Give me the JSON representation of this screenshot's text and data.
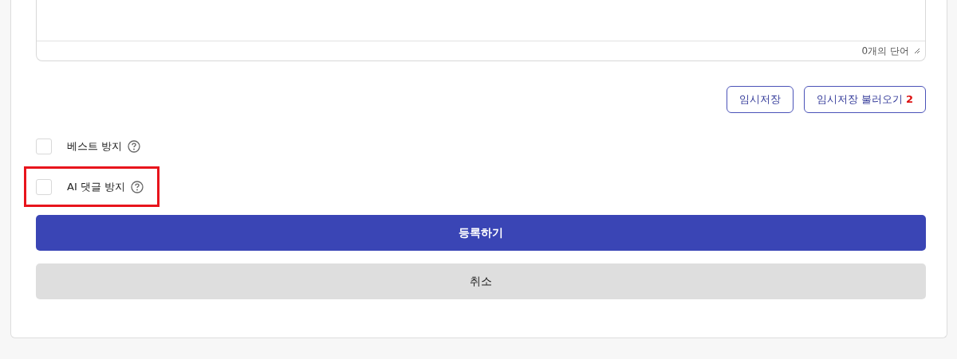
{
  "editor": {
    "word_count": "0개의 단어"
  },
  "draft_buttons": [
    {
      "label": "임시저장"
    },
    {
      "label": "임시저장 불러오기",
      "count": "2"
    }
  ],
  "options": [
    {
      "label": "베스트 방지",
      "checked": false,
      "highlighted": false
    },
    {
      "label": "AI 댓글 방지",
      "checked": false,
      "highlighted": true
    }
  ],
  "buttons": [
    {
      "label": "등록하기",
      "kind": "primary"
    },
    {
      "label": "취소",
      "kind": "secondary"
    }
  ]
}
